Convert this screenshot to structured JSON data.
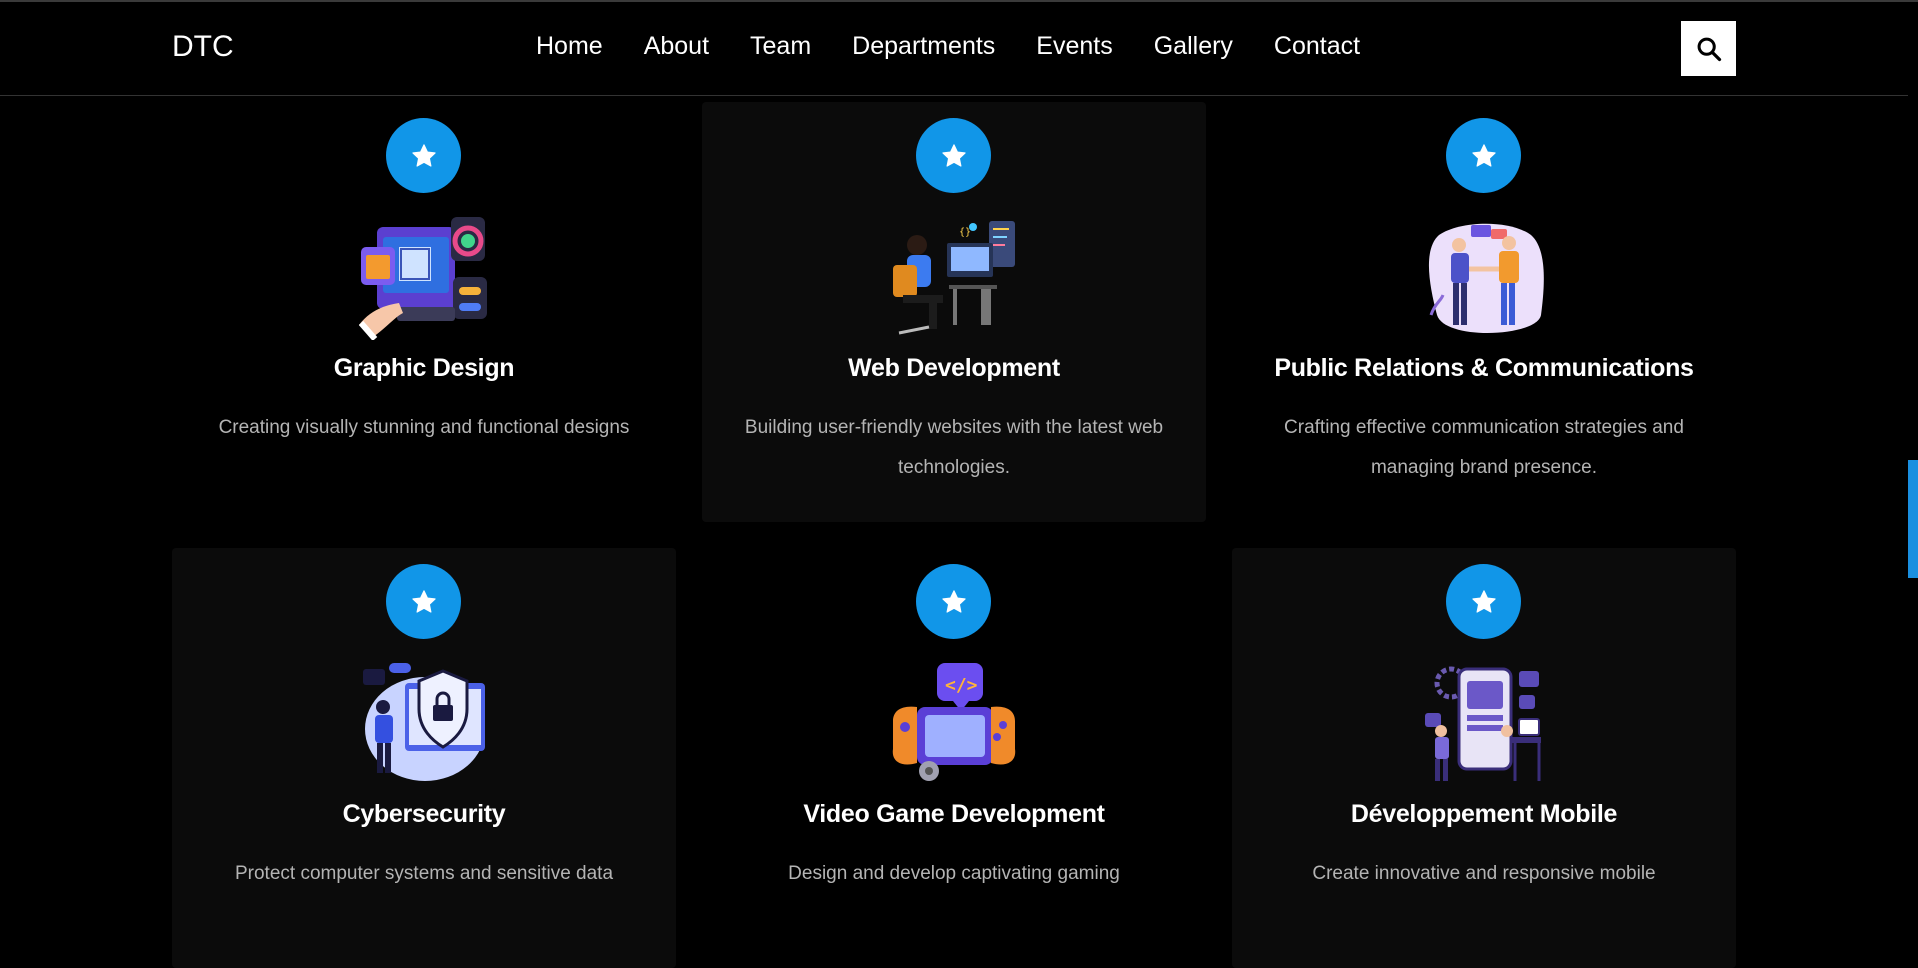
{
  "header": {
    "brand": "DTC",
    "nav": [
      "Home",
      "About",
      "Team",
      "Departments",
      "Events",
      "Gallery",
      "Contact"
    ]
  },
  "departments": [
    {
      "title": "Graphic Design",
      "description": "Creating visually stunning and functional designs",
      "icon": "star-icon",
      "illustration": "graphic-design-illustration"
    },
    {
      "title": "Web Development",
      "description": "Building user-friendly websites with the latest web technologies.",
      "icon": "star-icon",
      "illustration": "web-development-illustration"
    },
    {
      "title": "Public Relations & Communications",
      "description": "Crafting effective communication strategies and managing brand presence.",
      "icon": "star-icon",
      "illustration": "handshake-illustration"
    },
    {
      "title": "Cybersecurity",
      "description": "Protect computer systems and sensitive data",
      "icon": "star-icon",
      "illustration": "cybersecurity-illustration"
    },
    {
      "title": "Video Game Development",
      "description": "Design and develop captivating gaming",
      "icon": "star-icon",
      "illustration": "game-controller-illustration"
    },
    {
      "title": "Développement Mobile",
      "description": "Create innovative and responsive mobile",
      "icon": "star-icon",
      "illustration": "mobile-development-illustration"
    }
  ],
  "colors": {
    "accent": "#1196e8",
    "background": "#000000",
    "card": "#0b0b0b"
  }
}
